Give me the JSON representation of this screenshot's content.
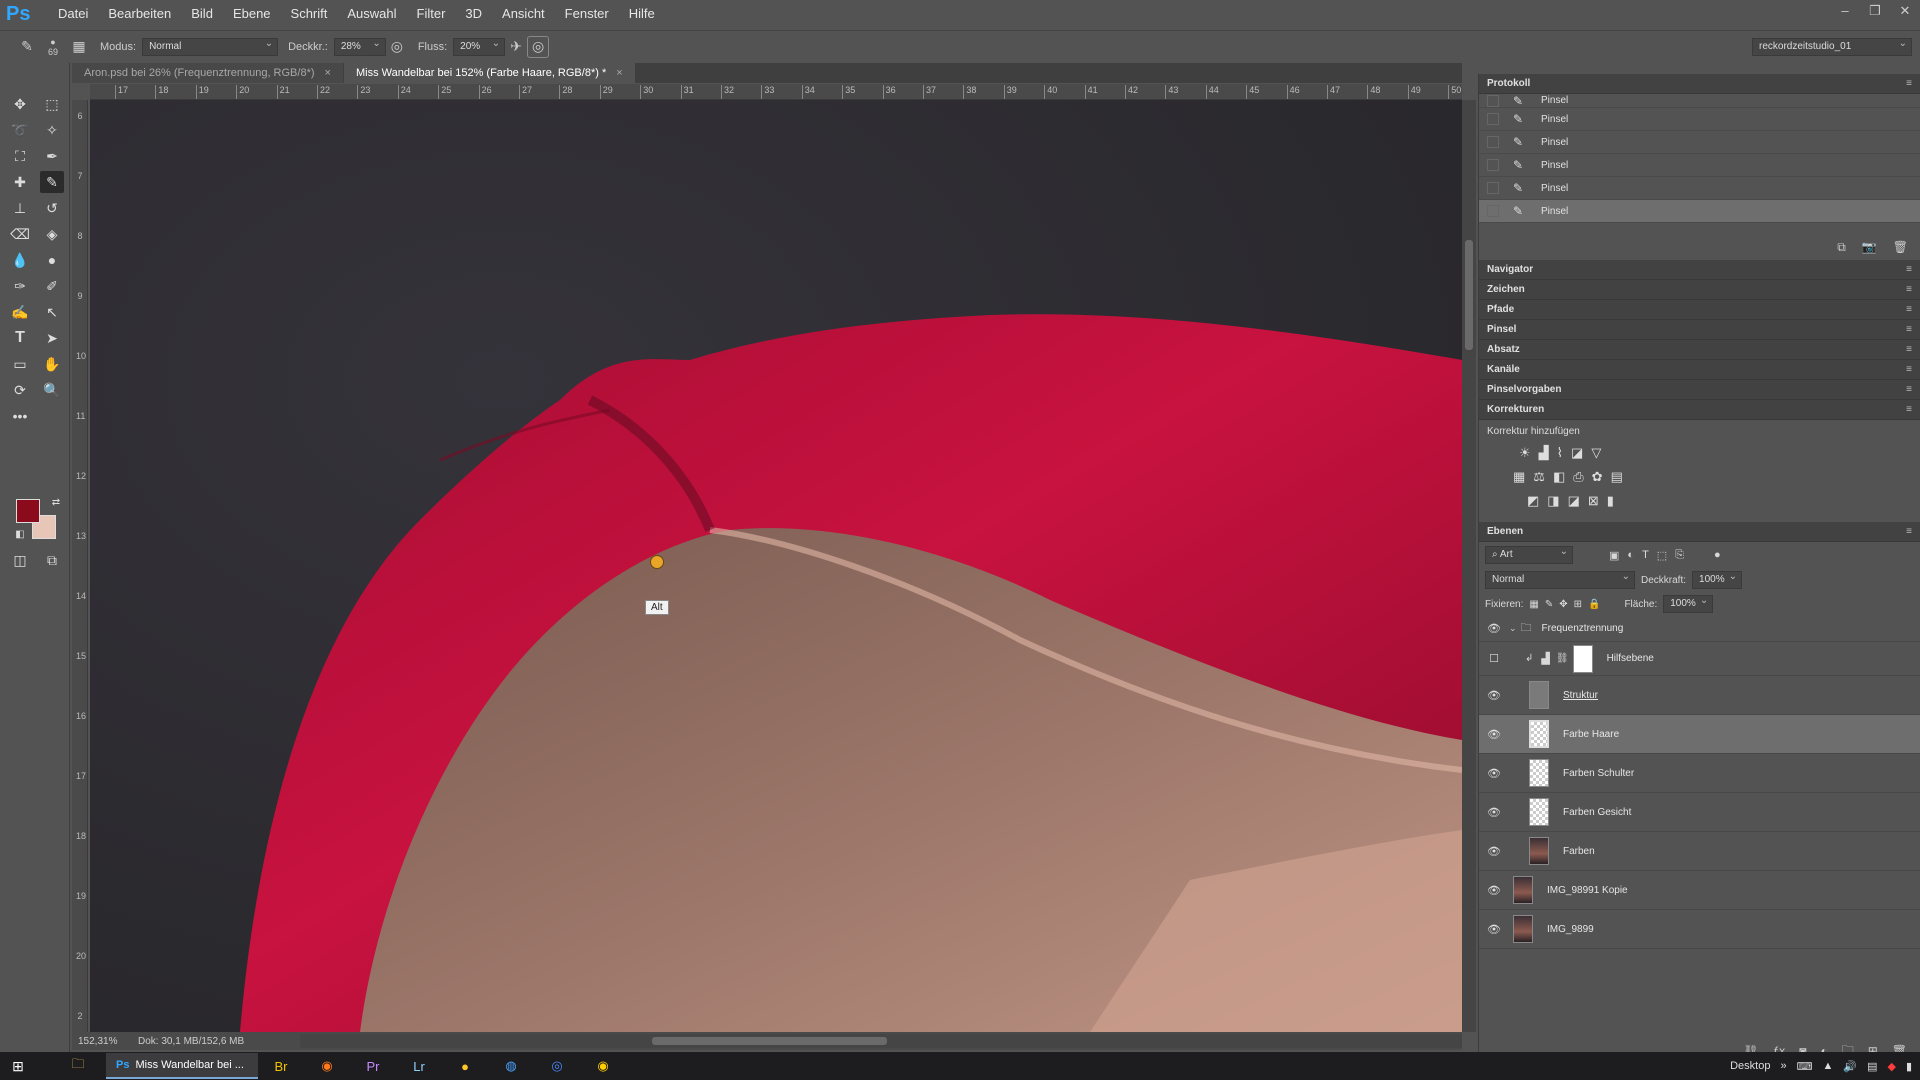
{
  "app": {
    "logo": "Ps"
  },
  "menu": [
    "Datei",
    "Bearbeiten",
    "Bild",
    "Ebene",
    "Schrift",
    "Auswahl",
    "Filter",
    "3D",
    "Ansicht",
    "Fenster",
    "Hilfe"
  ],
  "options": {
    "brush_size": "69",
    "modus_label": "Modus:",
    "modus_value": "Normal",
    "deckkraft_label": "Deckkr.:",
    "deckkraft_value": "28%",
    "fluss_label": "Fluss:",
    "fluss_value": "20%",
    "workspace": "reckordzeitstudio_01"
  },
  "tabs": [
    {
      "label": "Aron.psd bei 26% (Frequenztrennung, RGB/8*)",
      "close": "×"
    },
    {
      "label": "Miss Wandelbar bei 152% (Farbe Haare, RGB/8*) *",
      "close": "×"
    }
  ],
  "ruler_top": [
    "17",
    "18",
    "19",
    "20",
    "21",
    "22",
    "23",
    "24",
    "25",
    "26",
    "27",
    "28",
    "29",
    "30",
    "31",
    "32",
    "33",
    "34",
    "35",
    "36",
    "37",
    "38",
    "39",
    "40",
    "41",
    "42",
    "43",
    "44",
    "45",
    "46",
    "47",
    "48",
    "49",
    "50"
  ],
  "ruler_left": [
    "6",
    "7",
    "8",
    "9",
    "10",
    "11",
    "12",
    "13",
    "14",
    "15",
    "16",
    "17",
    "18",
    "19",
    "20",
    "2"
  ],
  "canvas": {
    "tooltip": "Alt"
  },
  "status": {
    "zoom": "152,31%",
    "doc": "Dok: 30,1 MB/152,6 MB",
    "arrow": "›"
  },
  "history": {
    "title": "Protokoll",
    "items": [
      "Pinsel",
      "Pinsel",
      "Pinsel",
      "Pinsel",
      "Pinsel",
      "Pinsel"
    ],
    "selected_index": 5
  },
  "collapsed_panels": [
    "Navigator",
    "Zeichen",
    "Pfade",
    "Pinsel",
    "Absatz",
    "Kanäle",
    "Pinselvorgaben"
  ],
  "korrekturen": {
    "title": "Korrekturen",
    "subtitle": "Korrektur hinzufügen"
  },
  "layers": {
    "title": "Ebenen",
    "filter": "Art",
    "blend": "Normal",
    "deckkraft_label": "Deckkraft:",
    "deckkraft_value": "100%",
    "fixieren_label": "Fixieren:",
    "flaeche_label": "Fläche:",
    "flaeche_value": "100%",
    "items": [
      {
        "name": "Frequenztrennung",
        "type": "group",
        "visible": true
      },
      {
        "name": "Hilfsebene",
        "type": "adjustment",
        "visible": false
      },
      {
        "name": "Struktur",
        "type": "gray",
        "visible": true
      },
      {
        "name": "Farbe Haare",
        "type": "transparent",
        "visible": true,
        "selected": true
      },
      {
        "name": "Farben Schulter",
        "type": "transparent",
        "visible": true
      },
      {
        "name": "Farben Gesicht",
        "type": "transparent",
        "visible": true
      },
      {
        "name": "Farben",
        "type": "photo",
        "visible": true
      },
      {
        "name": "IMG_98991 Kopie",
        "type": "photo",
        "visible": true
      },
      {
        "name": "IMG_9899",
        "type": "photo",
        "visible": true
      }
    ]
  },
  "taskbar": {
    "app_label": "Miss Wandelbar bei ...",
    "desktop": "Desktop"
  },
  "colors": {
    "foreground": "#8b0a1c",
    "background": "#e7c6b8",
    "hair": "#c8123f"
  }
}
